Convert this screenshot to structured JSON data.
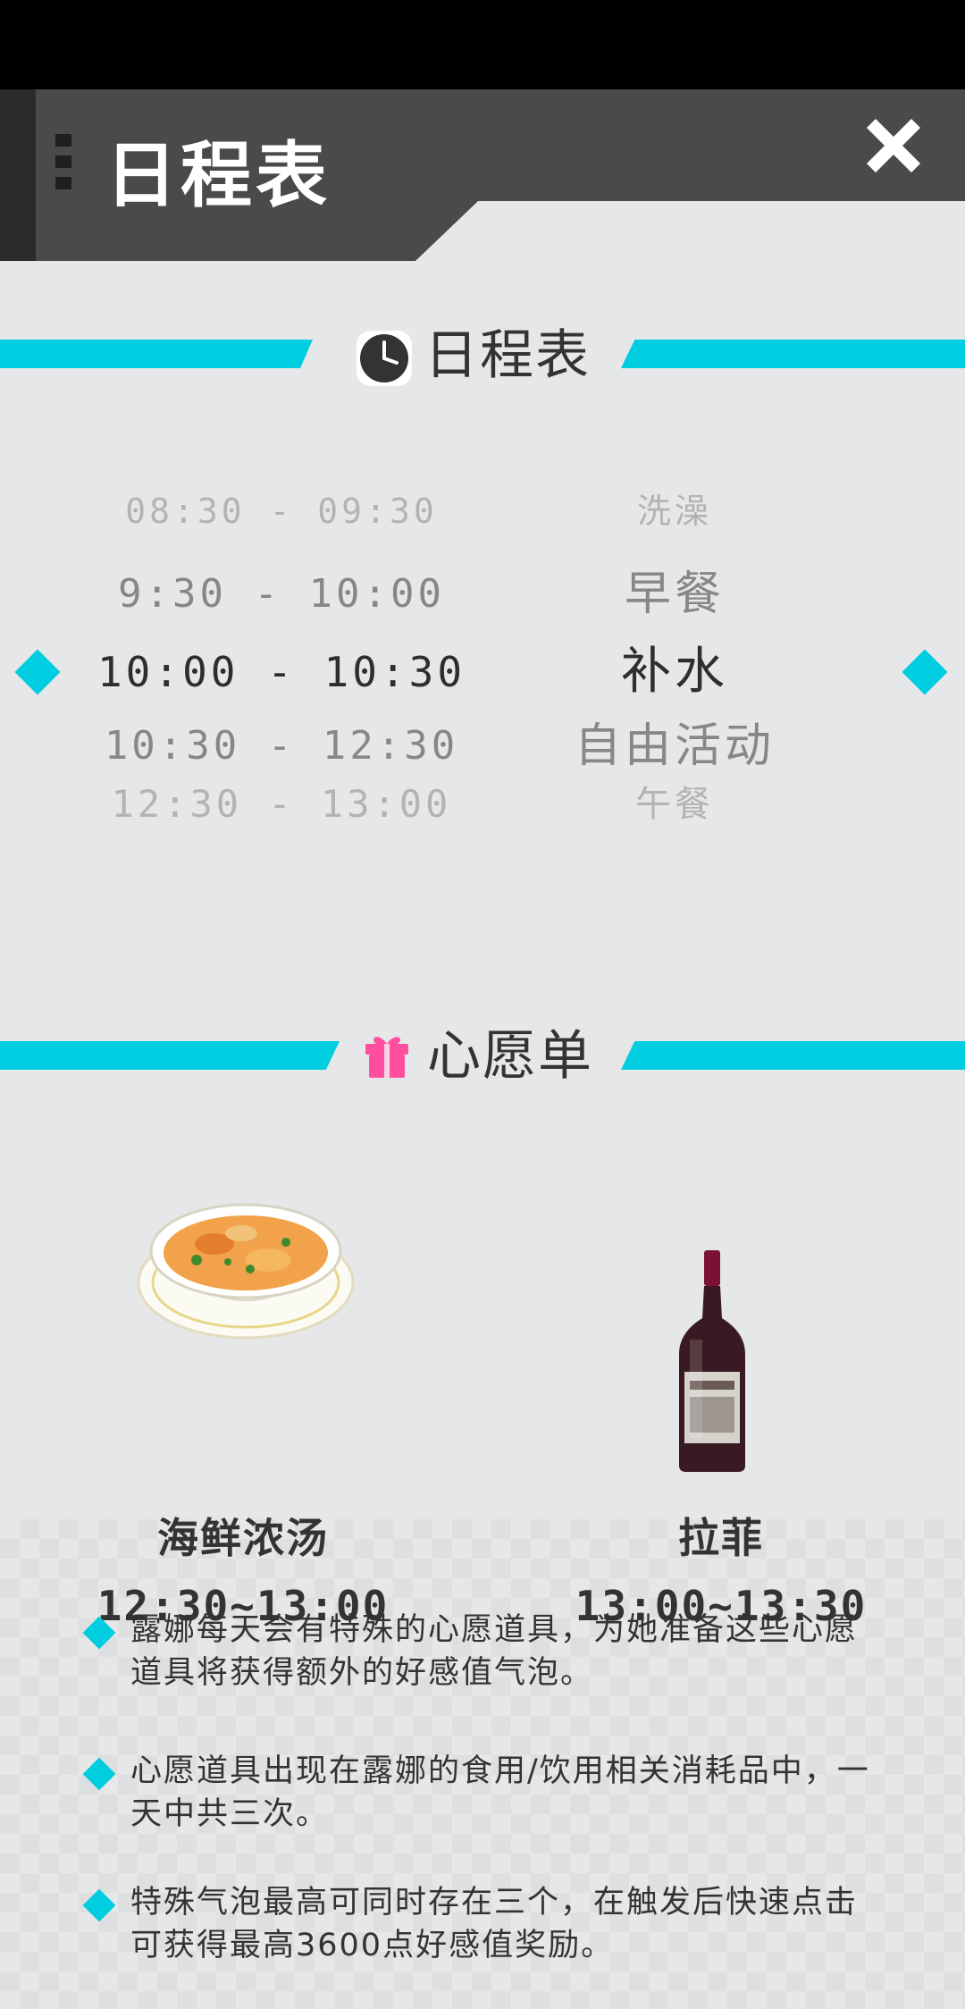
{
  "header": {
    "title": "日程表"
  },
  "schedule_section": {
    "title": "日程表"
  },
  "schedule": [
    {
      "time": "08:30 - 09:30",
      "activity": "洗澡"
    },
    {
      "time": "9:30 - 10:00",
      "activity": "早餐"
    },
    {
      "time": "10:00 - 10:30",
      "activity": "补水"
    },
    {
      "time": "10:30 - 12:30",
      "activity": "自由活动"
    },
    {
      "time": "12:30 - 13:00",
      "activity": "午餐"
    }
  ],
  "wishlist_section": {
    "title": "心愿单"
  },
  "wishlist": [
    {
      "name": "海鲜浓汤",
      "time": "12:30~13:00",
      "icon": "seafood-soup-bowl"
    },
    {
      "name": "拉菲",
      "time": "13:00~13:30",
      "icon": "wine-bottle"
    }
  ],
  "notes": [
    "露娜每天会有特殊的心愿道具，为她准备这些心愿道具将获得额外的好感值气泡。",
    "心愿道具出现在露娜的食用/饮用相关消耗品中，一天中共三次。",
    "特殊气泡最高可同时存在三个，在触发后快速点击可获得最高3600点好感值奖励。"
  ],
  "colors": {
    "accent": "#00cde0",
    "header": "#4a4a4a",
    "background": "#e6e7e8",
    "gift": "#ff4f9e"
  }
}
